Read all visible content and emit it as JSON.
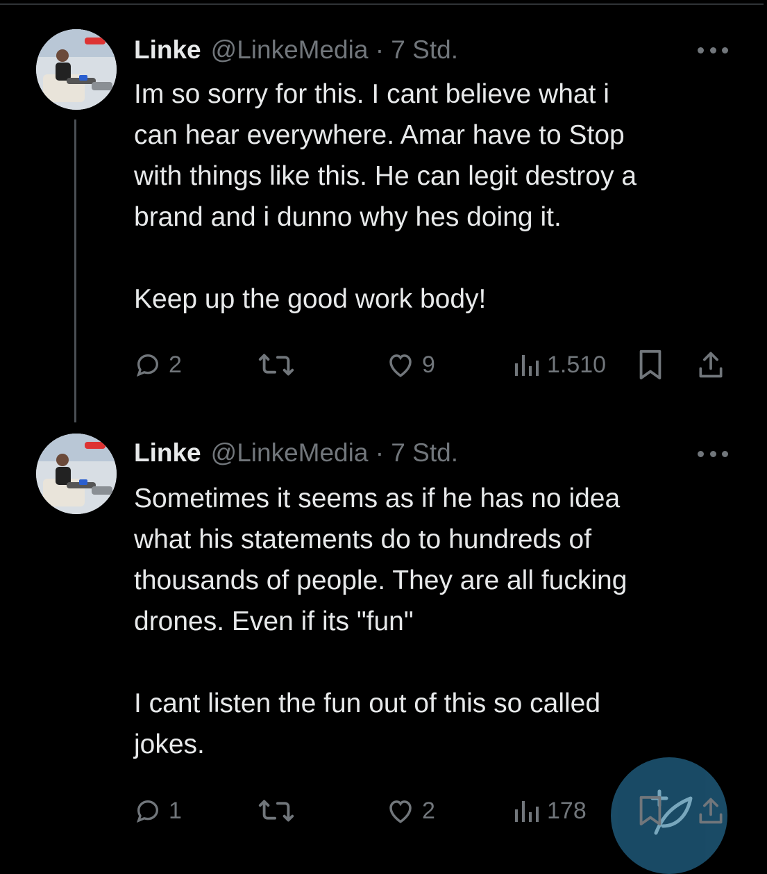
{
  "tweets": [
    {
      "author_name": "Linke",
      "author_handle": "@LinkeMedia · 7 Std.",
      "text": "Im so sorry for this. I cant believe what i\ncan hear everywhere. Amar have to Stop\nwith things like this. He can legit destroy a\nbrand and i dunno why hes doing it.\n\nKeep up the good work body!",
      "replies": "2",
      "likes": "9",
      "views": "1.510"
    },
    {
      "author_name": "Linke",
      "author_handle": "@LinkeMedia · 7 Std.",
      "text": "Sometimes it seems as if he has no idea\nwhat his statements do to hundreds of\nthousands of people. They are all fucking\ndrones. Even if its \"fun\"\n\nI cant listen the fun out of this so called\njokes.",
      "replies": "1",
      "likes": "2",
      "views": "178"
    }
  ],
  "icons": {
    "reply": "reply-icon",
    "retweet": "retweet-icon",
    "like": "heart-icon",
    "views": "views-icon",
    "bookmark": "bookmark-icon",
    "share": "share-icon",
    "more": "more-icon",
    "compose": "compose-icon"
  },
  "colors": {
    "background": "#000000",
    "text": "#e7e9ea",
    "muted": "#71767b",
    "fab": "#1b4f6b"
  }
}
